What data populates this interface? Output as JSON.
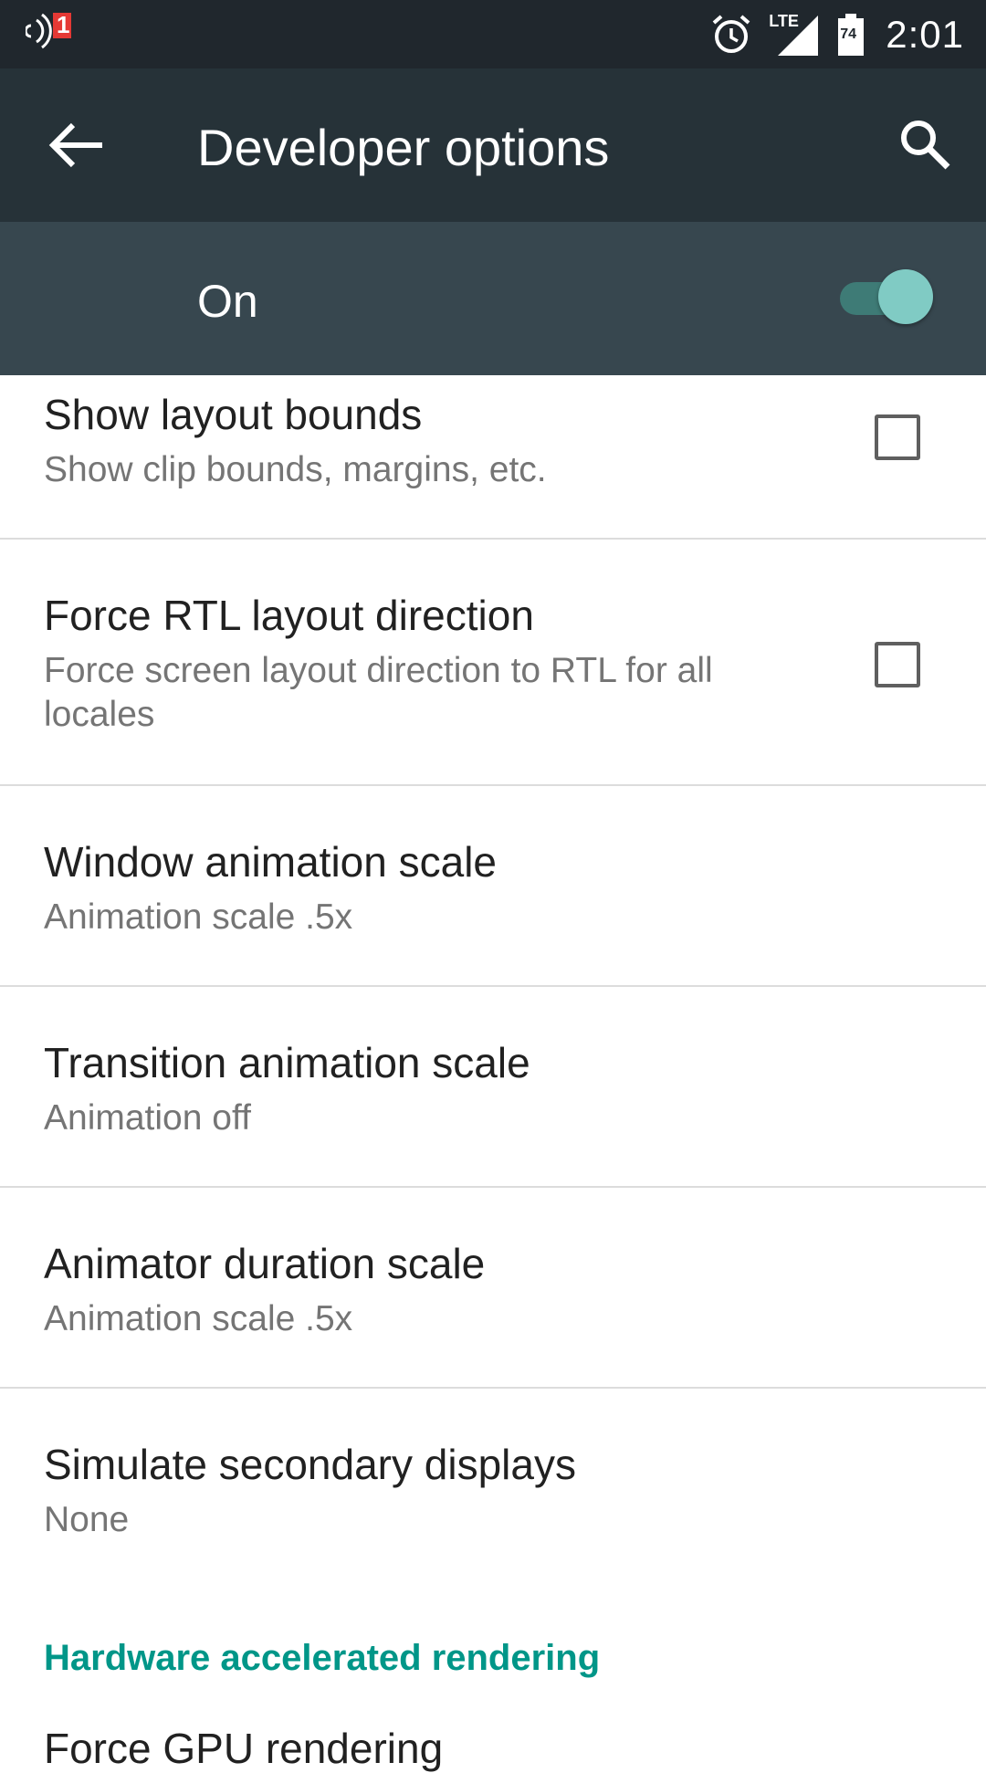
{
  "status_bar": {
    "time": "2:01",
    "notification_count": "1",
    "network_label": "LTE",
    "battery_level": "74",
    "icons": [
      "nfc-icon",
      "alarm-icon",
      "signal-icon",
      "battery-icon"
    ]
  },
  "toolbar": {
    "title": "Developer options",
    "back_icon": "arrow-back-icon",
    "search_icon": "search-icon"
  },
  "master_switch": {
    "label": "On",
    "state": true,
    "colors": {
      "track": "#3e7b76",
      "thumb": "#80cbc4"
    }
  },
  "settings": [
    {
      "title": "Show layout bounds",
      "summary": "Show clip bounds, margins, etc.",
      "control": "checkbox",
      "checked": false
    },
    {
      "title": "Force RTL layout direction",
      "summary": "Force screen layout direction to RTL for all locales",
      "control": "checkbox",
      "checked": false
    },
    {
      "title": "Window animation scale",
      "summary": "Animation scale .5x"
    },
    {
      "title": "Transition animation scale",
      "summary": "Animation off"
    },
    {
      "title": "Animator duration scale",
      "summary": "Animation scale .5x"
    },
    {
      "title": "Simulate secondary displays",
      "summary": "None"
    }
  ],
  "section": {
    "header": "Hardware accelerated rendering",
    "accent_color": "#009688",
    "next_item_partial": "Force GPU rendering"
  }
}
